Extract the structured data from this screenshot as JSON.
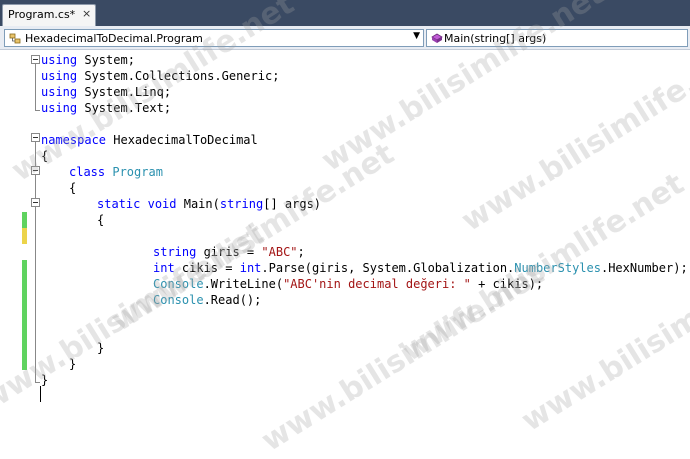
{
  "tab": {
    "label": "Program.cs*",
    "close": "×"
  },
  "navbar": {
    "type_combo": "HexadecimalToDecimal.Program",
    "member_combo": "Main(string[] args)"
  },
  "watermark": "www.bilisimlife.net",
  "code": {
    "l1": [
      "using",
      " System;"
    ],
    "l2": [
      "using",
      " System.Collections.Generic;"
    ],
    "l3": [
      "using",
      " System.Linq;"
    ],
    "l4": [
      "using",
      " System.Text;"
    ],
    "l6": [
      "namespace",
      " HexadecimalToDecimal"
    ],
    "l7": "{",
    "l8": [
      "class",
      "Program"
    ],
    "l9": "{",
    "l10": [
      "static",
      "void",
      "Main(",
      "string",
      "[] args)"
    ],
    "l11": "{",
    "l13": [
      "string",
      " giris = ",
      "\"ABC\"",
      ";"
    ],
    "l14": [
      "int",
      " cikis = ",
      "int",
      ".Parse(giris, System.Globalization.",
      "NumberStyles",
      ".HexNumber);"
    ],
    "l15": [
      "Console",
      ".WriteLine(",
      "\"ABC'nin decimal değeri: \"",
      " + cikis);"
    ],
    "l16": [
      "Console",
      ".Read();"
    ],
    "l19": "}",
    "l20": "}",
    "l21": "}"
  }
}
